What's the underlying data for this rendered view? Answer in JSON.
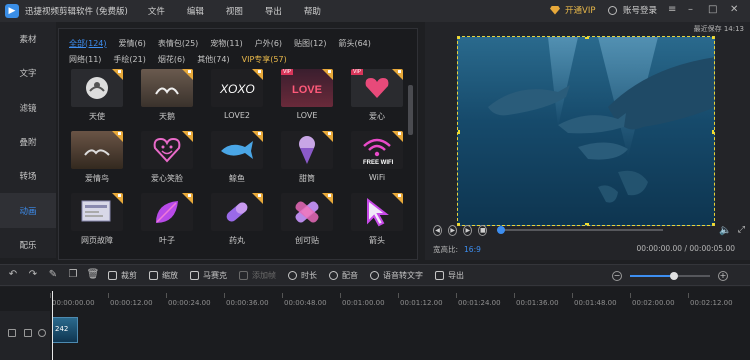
{
  "app": {
    "title": "迅捷视频剪辑软件 (免费版)",
    "menu": [
      "文件",
      "编辑",
      "视图",
      "导出",
      "帮助"
    ],
    "vip_label": "开通VIP",
    "login_label": "账号登录"
  },
  "sidebar": {
    "items": [
      {
        "label": "素材"
      },
      {
        "label": "文字"
      },
      {
        "label": "滤镜"
      },
      {
        "label": "叠附"
      },
      {
        "label": "转场"
      },
      {
        "label": "动画"
      },
      {
        "label": "配乐"
      }
    ],
    "active_index": 5
  },
  "categories": {
    "row1": [
      "全部(124)",
      "爱情(6)",
      "表情包(25)",
      "宠物(11)",
      "户外(6)",
      "贴图(12)",
      "箭头(64)"
    ],
    "row2": [
      "网络(11)",
      "手绘(21)",
      "烟花(6)",
      "其他(74)",
      "VIP专享(57)"
    ],
    "active": "全部(124)"
  },
  "materials": [
    {
      "label": "天使",
      "icon": "angel-icon"
    },
    {
      "label": "天鹅",
      "icon": "swan-icon"
    },
    {
      "label": "LOVE2",
      "icon": "xoxo-icon"
    },
    {
      "label": "LOVE",
      "icon": "love-icon"
    },
    {
      "label": "爱心",
      "icon": "heart-icon"
    },
    {
      "label": "爱情鸟",
      "icon": "lovebird-icon"
    },
    {
      "label": "爱心笑脸",
      "icon": "smile-heart-icon"
    },
    {
      "label": "鲸鱼",
      "icon": "whale-icon"
    },
    {
      "label": "甜筒",
      "icon": "ice-cream-icon"
    },
    {
      "label": "WiFi",
      "icon": "wifi-icon"
    },
    {
      "label": "网页故障",
      "icon": "webpage-icon"
    },
    {
      "label": "叶子",
      "icon": "leaf-icon"
    },
    {
      "label": "药丸",
      "icon": "pill-icon"
    },
    {
      "label": "创可贴",
      "icon": "bandage-icon"
    },
    {
      "label": "箭头",
      "icon": "cursor-icon"
    }
  ],
  "preview": {
    "save_info": "最近保存 14:13",
    "aspect_label": "宽高比:",
    "aspect_value": "16:9",
    "time_display": "00:00:00.00 / 00:00:05.00",
    "accent": "#3d8ef0"
  },
  "toolbar": {
    "tools": [
      {
        "label": "裁剪",
        "disabled": false
      },
      {
        "label": "缩放",
        "disabled": false
      },
      {
        "label": "马赛克",
        "disabled": false
      },
      {
        "label": "添加帧",
        "disabled": true
      },
      {
        "label": "时长",
        "disabled": false
      },
      {
        "label": "配音",
        "disabled": false
      },
      {
        "label": "语音转文字",
        "disabled": false
      },
      {
        "label": "导出",
        "disabled": false
      }
    ],
    "zoom_level": 0.55
  },
  "timeline": {
    "ticks": [
      "00:00:00.00",
      "00:00:12.00",
      "00:00:24.00",
      "00:00:36.00",
      "00:00:48.00",
      "00:01:00.00",
      "00:01:12.00",
      "00:01:24.00",
      "00:01:36.00",
      "00:01:48.00",
      "00:02:00.00",
      "00:02:12.00"
    ],
    "clip_label": "242"
  }
}
